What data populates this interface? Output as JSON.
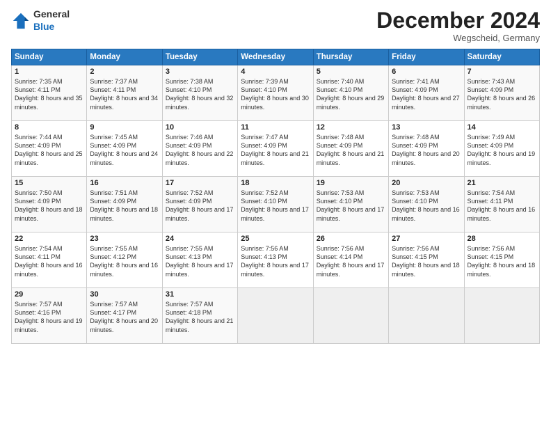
{
  "header": {
    "logo": {
      "general": "General",
      "blue": "Blue"
    },
    "month": "December 2024",
    "location": "Wegscheid, Germany"
  },
  "days_of_week": [
    "Sunday",
    "Monday",
    "Tuesday",
    "Wednesday",
    "Thursday",
    "Friday",
    "Saturday"
  ],
  "weeks": [
    [
      {
        "day": 1,
        "sunrise": "Sunrise: 7:35 AM",
        "sunset": "Sunset: 4:11 PM",
        "daylight": "Daylight: 8 hours and 35 minutes."
      },
      {
        "day": 2,
        "sunrise": "Sunrise: 7:37 AM",
        "sunset": "Sunset: 4:11 PM",
        "daylight": "Daylight: 8 hours and 34 minutes."
      },
      {
        "day": 3,
        "sunrise": "Sunrise: 7:38 AM",
        "sunset": "Sunset: 4:10 PM",
        "daylight": "Daylight: 8 hours and 32 minutes."
      },
      {
        "day": 4,
        "sunrise": "Sunrise: 7:39 AM",
        "sunset": "Sunset: 4:10 PM",
        "daylight": "Daylight: 8 hours and 30 minutes."
      },
      {
        "day": 5,
        "sunrise": "Sunrise: 7:40 AM",
        "sunset": "Sunset: 4:10 PM",
        "daylight": "Daylight: 8 hours and 29 minutes."
      },
      {
        "day": 6,
        "sunrise": "Sunrise: 7:41 AM",
        "sunset": "Sunset: 4:09 PM",
        "daylight": "Daylight: 8 hours and 27 minutes."
      },
      {
        "day": 7,
        "sunrise": "Sunrise: 7:43 AM",
        "sunset": "Sunset: 4:09 PM",
        "daylight": "Daylight: 8 hours and 26 minutes."
      }
    ],
    [
      {
        "day": 8,
        "sunrise": "Sunrise: 7:44 AM",
        "sunset": "Sunset: 4:09 PM",
        "daylight": "Daylight: 8 hours and 25 minutes."
      },
      {
        "day": 9,
        "sunrise": "Sunrise: 7:45 AM",
        "sunset": "Sunset: 4:09 PM",
        "daylight": "Daylight: 8 hours and 24 minutes."
      },
      {
        "day": 10,
        "sunrise": "Sunrise: 7:46 AM",
        "sunset": "Sunset: 4:09 PM",
        "daylight": "Daylight: 8 hours and 22 minutes."
      },
      {
        "day": 11,
        "sunrise": "Sunrise: 7:47 AM",
        "sunset": "Sunset: 4:09 PM",
        "daylight": "Daylight: 8 hours and 21 minutes."
      },
      {
        "day": 12,
        "sunrise": "Sunrise: 7:48 AM",
        "sunset": "Sunset: 4:09 PM",
        "daylight": "Daylight: 8 hours and 21 minutes."
      },
      {
        "day": 13,
        "sunrise": "Sunrise: 7:48 AM",
        "sunset": "Sunset: 4:09 PM",
        "daylight": "Daylight: 8 hours and 20 minutes."
      },
      {
        "day": 14,
        "sunrise": "Sunrise: 7:49 AM",
        "sunset": "Sunset: 4:09 PM",
        "daylight": "Daylight: 8 hours and 19 minutes."
      }
    ],
    [
      {
        "day": 15,
        "sunrise": "Sunrise: 7:50 AM",
        "sunset": "Sunset: 4:09 PM",
        "daylight": "Daylight: 8 hours and 18 minutes."
      },
      {
        "day": 16,
        "sunrise": "Sunrise: 7:51 AM",
        "sunset": "Sunset: 4:09 PM",
        "daylight": "Daylight: 8 hours and 18 minutes."
      },
      {
        "day": 17,
        "sunrise": "Sunrise: 7:52 AM",
        "sunset": "Sunset: 4:09 PM",
        "daylight": "Daylight: 8 hours and 17 minutes."
      },
      {
        "day": 18,
        "sunrise": "Sunrise: 7:52 AM",
        "sunset": "Sunset: 4:10 PM",
        "daylight": "Daylight: 8 hours and 17 minutes."
      },
      {
        "day": 19,
        "sunrise": "Sunrise: 7:53 AM",
        "sunset": "Sunset: 4:10 PM",
        "daylight": "Daylight: 8 hours and 17 minutes."
      },
      {
        "day": 20,
        "sunrise": "Sunrise: 7:53 AM",
        "sunset": "Sunset: 4:10 PM",
        "daylight": "Daylight: 8 hours and 16 minutes."
      },
      {
        "day": 21,
        "sunrise": "Sunrise: 7:54 AM",
        "sunset": "Sunset: 4:11 PM",
        "daylight": "Daylight: 8 hours and 16 minutes."
      }
    ],
    [
      {
        "day": 22,
        "sunrise": "Sunrise: 7:54 AM",
        "sunset": "Sunset: 4:11 PM",
        "daylight": "Daylight: 8 hours and 16 minutes."
      },
      {
        "day": 23,
        "sunrise": "Sunrise: 7:55 AM",
        "sunset": "Sunset: 4:12 PM",
        "daylight": "Daylight: 8 hours and 16 minutes."
      },
      {
        "day": 24,
        "sunrise": "Sunrise: 7:55 AM",
        "sunset": "Sunset: 4:13 PM",
        "daylight": "Daylight: 8 hours and 17 minutes."
      },
      {
        "day": 25,
        "sunrise": "Sunrise: 7:56 AM",
        "sunset": "Sunset: 4:13 PM",
        "daylight": "Daylight: 8 hours and 17 minutes."
      },
      {
        "day": 26,
        "sunrise": "Sunrise: 7:56 AM",
        "sunset": "Sunset: 4:14 PM",
        "daylight": "Daylight: 8 hours and 17 minutes."
      },
      {
        "day": 27,
        "sunrise": "Sunrise: 7:56 AM",
        "sunset": "Sunset: 4:15 PM",
        "daylight": "Daylight: 8 hours and 18 minutes."
      },
      {
        "day": 28,
        "sunrise": "Sunrise: 7:56 AM",
        "sunset": "Sunset: 4:15 PM",
        "daylight": "Daylight: 8 hours and 18 minutes."
      }
    ],
    [
      {
        "day": 29,
        "sunrise": "Sunrise: 7:57 AM",
        "sunset": "Sunset: 4:16 PM",
        "daylight": "Daylight: 8 hours and 19 minutes."
      },
      {
        "day": 30,
        "sunrise": "Sunrise: 7:57 AM",
        "sunset": "Sunset: 4:17 PM",
        "daylight": "Daylight: 8 hours and 20 minutes."
      },
      {
        "day": 31,
        "sunrise": "Sunrise: 7:57 AM",
        "sunset": "Sunset: 4:18 PM",
        "daylight": "Daylight: 8 hours and 21 minutes."
      },
      null,
      null,
      null,
      null
    ]
  ]
}
